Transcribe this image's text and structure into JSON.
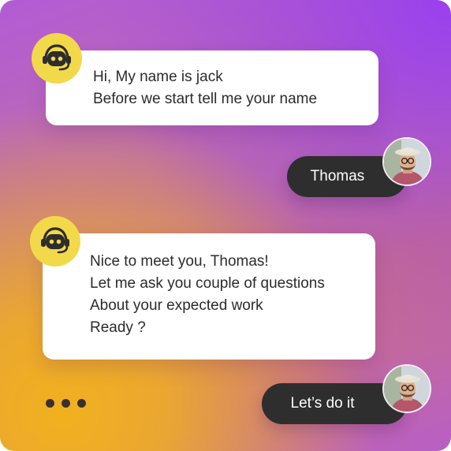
{
  "conversation": {
    "bot_message_1": {
      "lines": [
        "Hi, My name is jack",
        "Before we start tell me your name"
      ]
    },
    "user_reply_1": "Thomas",
    "bot_message_2": {
      "lines": [
        "Nice to meet you, Thomas!",
        "Let me ask you couple of questions",
        "About your expected work",
        "Ready ?"
      ]
    },
    "user_reply_2": "Let’s do it"
  },
  "icons": {
    "bot_avatar": "robot-headset-icon",
    "user_avatar": "user-photo-avatar",
    "typing": "typing-indicator-dots"
  },
  "colors": {
    "bot_avatar_bg": "#f2d94a",
    "user_bubble_bg": "#2e2e2e",
    "bot_bubble_bg": "#ffffff",
    "gradient_purple": "#9a40ef",
    "gradient_orange": "#f1b11f"
  }
}
